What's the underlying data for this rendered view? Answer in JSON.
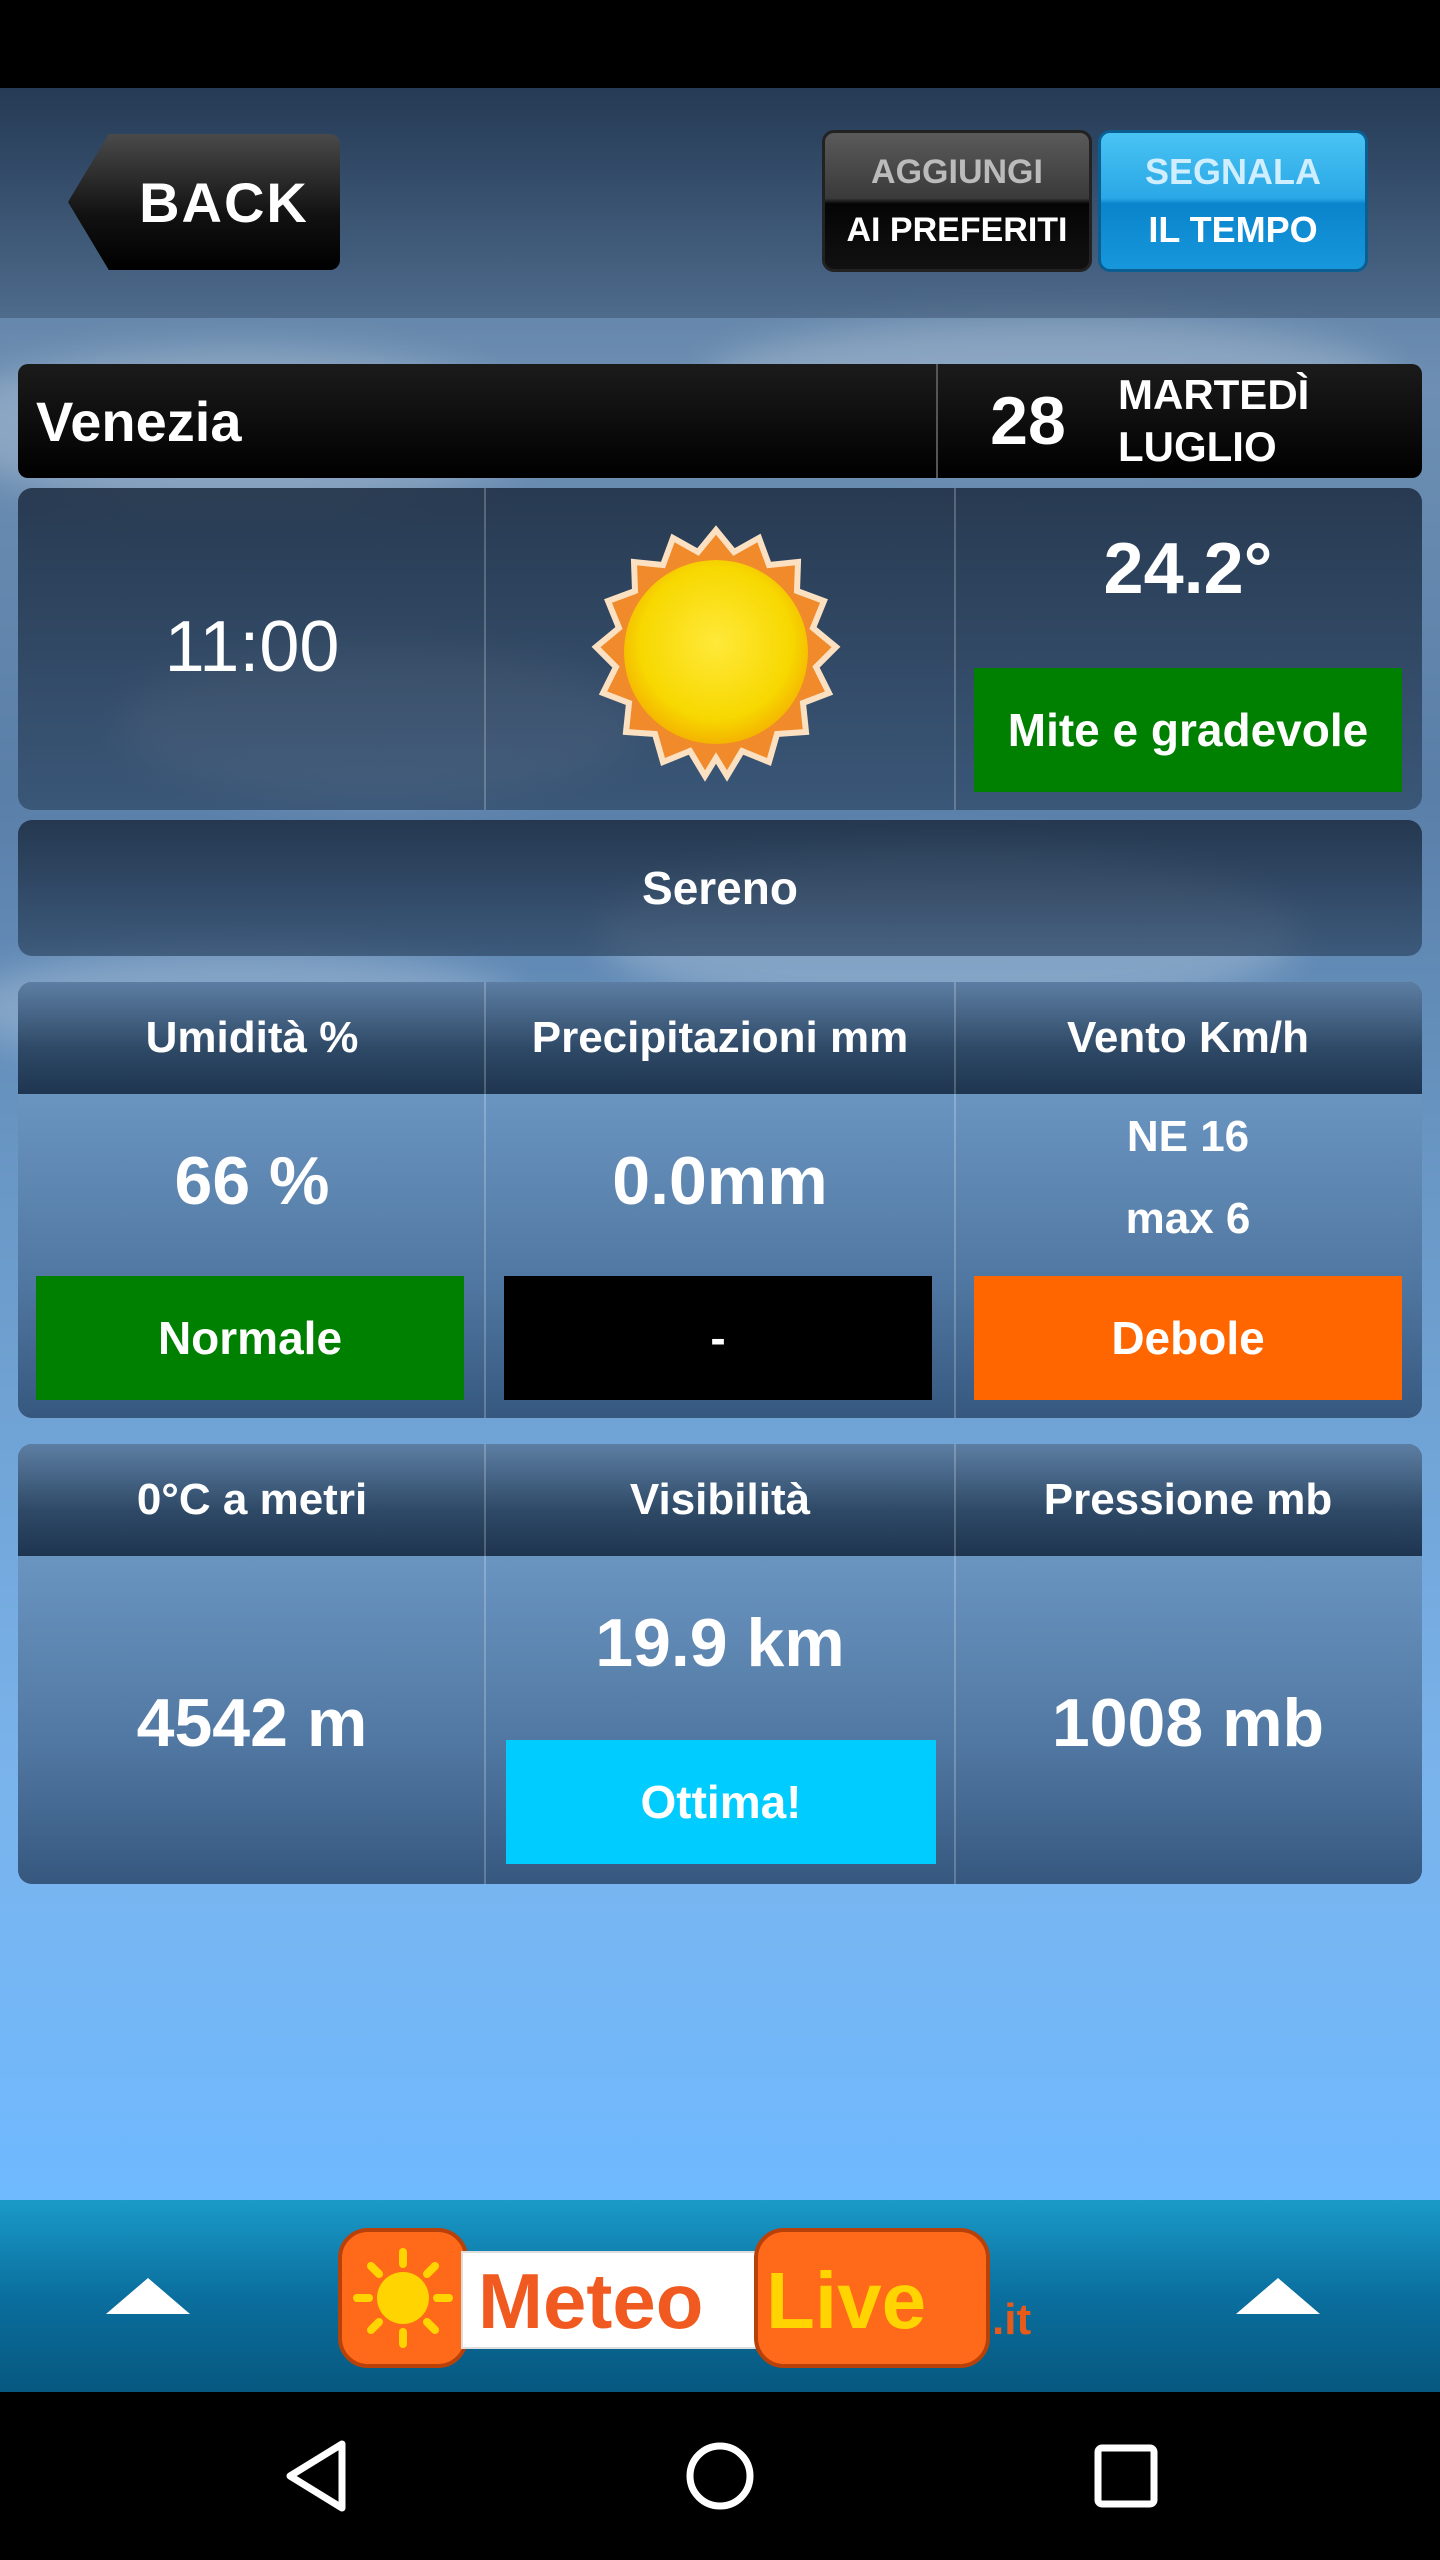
{
  "header": {
    "back_label": "BACK",
    "favorites_line1": "AGGIUNGI",
    "favorites_line2": "AI PREFERITI",
    "report_line1": "SEGNALA",
    "report_line2": "IL TEMPO"
  },
  "location": {
    "city": "Venezia",
    "day_number": "28",
    "weekday": "MARTEDÌ",
    "month": "LUGLIO"
  },
  "current": {
    "time": "11:00",
    "weather_icon": "sun-icon",
    "temperature": "24.2°",
    "comfort_label": "Mite e gradevole",
    "comfort_color": "#008000",
    "condition": "Sereno"
  },
  "details_row1": {
    "headers": [
      "Umidità %",
      "Precipitazioni mm",
      "Vento Km/h"
    ],
    "humidity_value": "66 %",
    "humidity_status": "Normale",
    "humidity_color": "#008000",
    "precip_value": "0.0mm",
    "precip_status": "-",
    "precip_color": "#000000",
    "wind_direction": "NE 16",
    "wind_max": "max 6",
    "wind_status": "Debole",
    "wind_color": "#ff6600"
  },
  "details_row2": {
    "headers": [
      "0°C a metri",
      "Visibilità",
      "Pressione mb"
    ],
    "freezing_level": "4542 m",
    "visibility_value": "19.9 km",
    "visibility_status": "Ottima!",
    "visibility_color": "#00ccff",
    "pressure_value": "1008 mb"
  },
  "footer": {
    "logo_meteo": "Meteo",
    "logo_live": "Live",
    "logo_domain": ".it"
  }
}
